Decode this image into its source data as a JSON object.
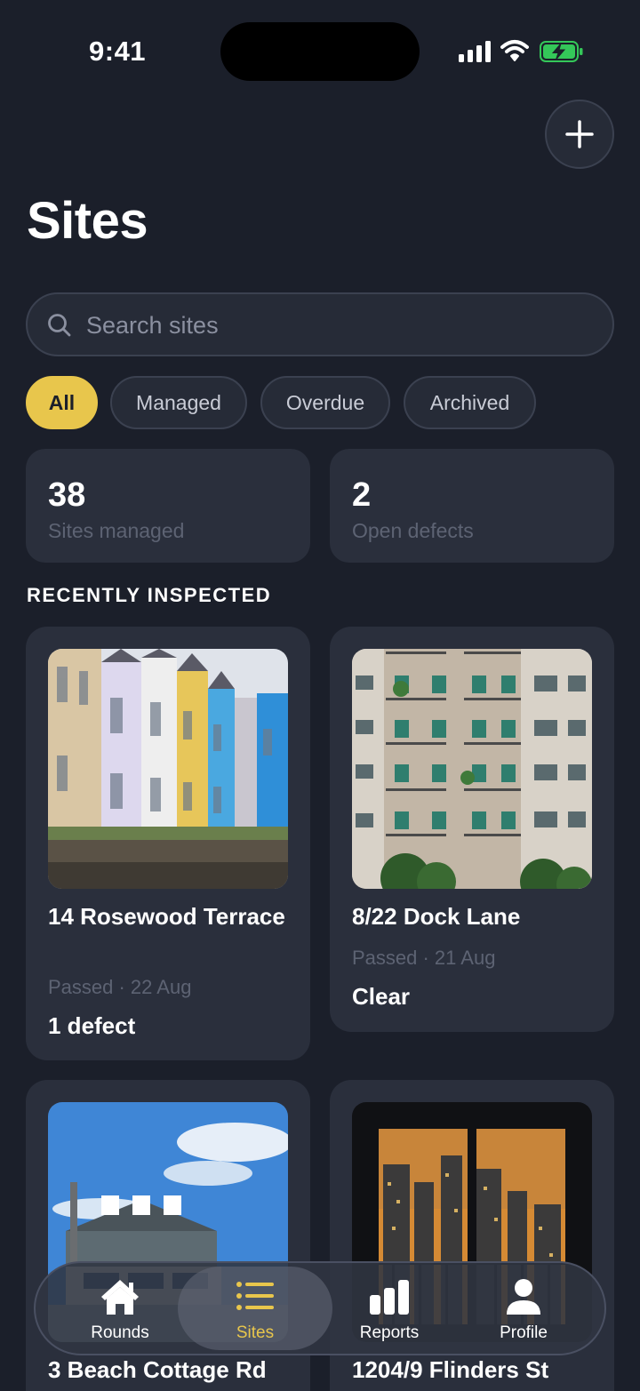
{
  "status_bar": {
    "time": "9:41"
  },
  "header": {
    "title": "Sites"
  },
  "search": {
    "placeholder": "Search sites"
  },
  "filters": [
    {
      "label": "All",
      "active": true
    },
    {
      "label": "Managed",
      "active": false
    },
    {
      "label": "Overdue",
      "active": false
    },
    {
      "label": "Archived",
      "active": false
    }
  ],
  "stats": [
    {
      "value": "38",
      "label": "Sites managed"
    },
    {
      "value": "2",
      "label": "Open defects"
    }
  ],
  "section": {
    "title": "RECENTLY INSPECTED"
  },
  "sites": [
    {
      "name": "14 Rosewood Terrace",
      "meta": "Passed · 22 Aug",
      "status": "1 defect"
    },
    {
      "name": "8/22 Dock Lane",
      "meta": "Passed · 21 Aug",
      "status": "Clear"
    },
    {
      "name": "3 Beach Cottage Rd",
      "meta": "",
      "status": ""
    },
    {
      "name": "1204/9 Flinders St",
      "meta": "",
      "status": ""
    }
  ],
  "tabs": [
    {
      "label": "Rounds",
      "icon": "home-icon",
      "active": false
    },
    {
      "label": "Sites",
      "icon": "list-icon",
      "active": true
    },
    {
      "label": "Reports",
      "icon": "bar-chart-icon",
      "active": false
    },
    {
      "label": "Profile",
      "icon": "person-icon",
      "active": false
    }
  ],
  "colors": {
    "background": "#1b1f2a",
    "card": "#2a2f3c",
    "accent": "#e8c64c",
    "battery": "#34c759"
  }
}
